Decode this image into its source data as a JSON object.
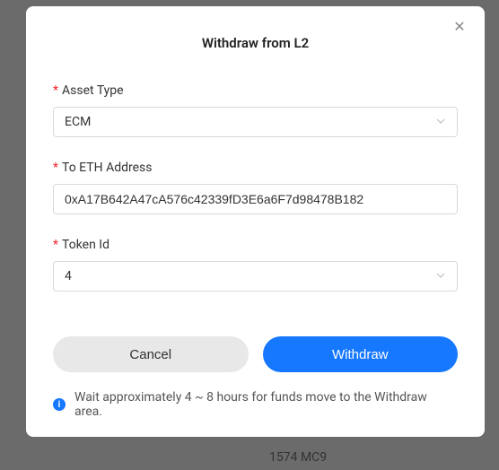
{
  "modal": {
    "title": "Withdraw from L2",
    "close_aria": "Close"
  },
  "form": {
    "asset_type": {
      "label": "Asset Type",
      "value": "ECM"
    },
    "to_address": {
      "label": "To ETH Address",
      "value": "0xA17B642A47cA576c42339fD3E6a6F7d98478B182"
    },
    "token_id": {
      "label": "Token Id",
      "value": "4"
    }
  },
  "buttons": {
    "cancel": "Cancel",
    "withdraw": "Withdraw"
  },
  "info": {
    "message": "Wait approximately 4 ~ 8 hours for funds move to the Withdraw area."
  },
  "backdrop": {
    "item": "1574 MC9"
  }
}
